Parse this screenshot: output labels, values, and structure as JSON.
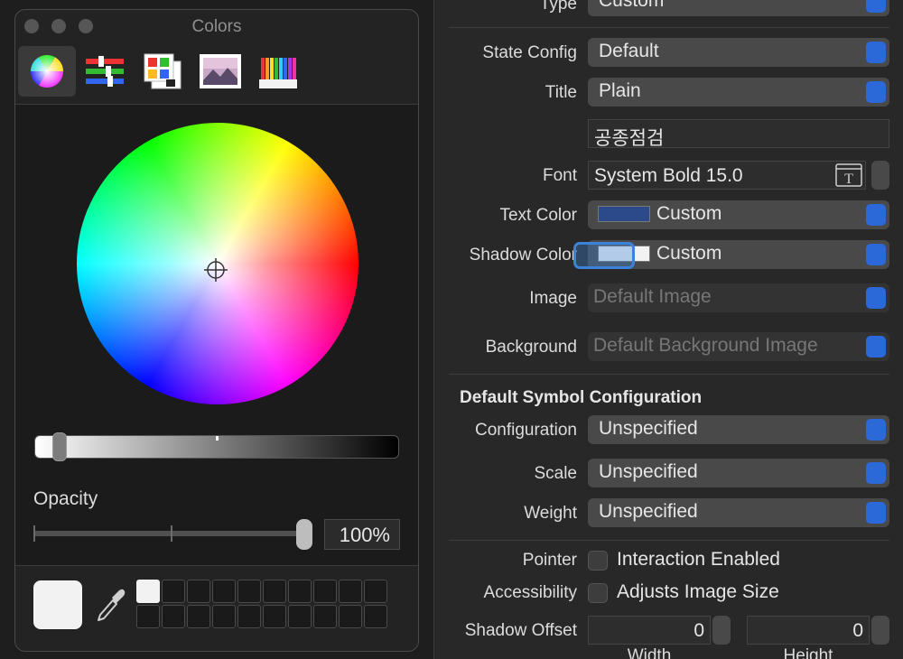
{
  "colors_panel": {
    "title": "Colors",
    "toolbar": [
      {
        "name": "color-wheel-tab-icon",
        "selected": true
      },
      {
        "name": "color-sliders-tab-icon",
        "selected": false
      },
      {
        "name": "color-palettes-tab-icon",
        "selected": false
      },
      {
        "name": "image-palettes-tab-icon",
        "selected": false
      },
      {
        "name": "pencils-tab-icon",
        "selected": false
      }
    ],
    "opacity_label": "Opacity",
    "opacity_value": "100%",
    "opacity_level": 1.0,
    "current_color": "#f2f2f2"
  },
  "inspector": {
    "type_label": "Type",
    "type_value": "Custom",
    "state_config_label": "State Config",
    "state_config_value": "Default",
    "title_label": "Title",
    "title_value": "Plain",
    "title_text": "공종점검",
    "font_label": "Font",
    "font_value": "System Bold 15.0",
    "text_color_label": "Text Color",
    "text_color_value": "Custom",
    "text_color_swatch": "#2c4a8a",
    "shadow_color_label": "Shadow Color",
    "shadow_color_value": "Custom",
    "shadow_color_swatch": "#f2f2f2",
    "image_label": "Image",
    "image_placeholder": "Default Image",
    "background_label": "Background",
    "background_placeholder": "Default Background Image",
    "symbol_section_title": "Default Symbol Configuration",
    "configuration_label": "Configuration",
    "configuration_value": "Unspecified",
    "scale_label": "Scale",
    "scale_value": "Unspecified",
    "weight_label": "Weight",
    "weight_value": "Unspecified",
    "pointer_label": "Pointer",
    "pointer_check_label": "Interaction Enabled",
    "accessibility_label": "Accessibility",
    "accessibility_check_label": "Adjusts Image Size",
    "shadow_offset_label": "Shadow Offset",
    "shadow_offset_width": "0",
    "shadow_offset_height": "0",
    "width_label": "Width",
    "height_label": "Height"
  }
}
